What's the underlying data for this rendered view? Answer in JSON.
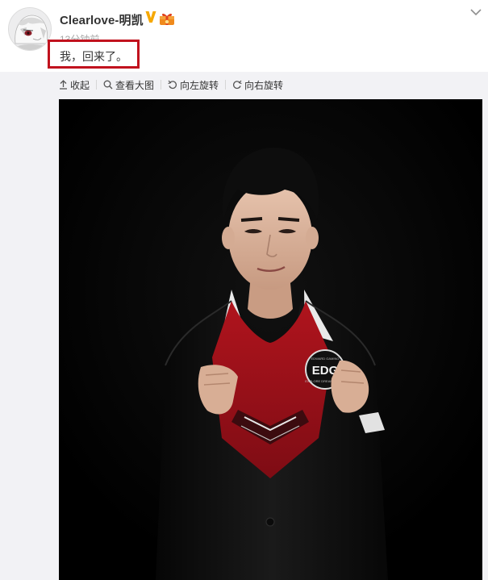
{
  "post": {
    "username": "Clearlove-明凯",
    "time": "13分钟前",
    "text": "我，回来了。"
  },
  "badges": {
    "verified": "verified-v-icon",
    "gift": "gift-icon",
    "verified_color": "#f6a800"
  },
  "toolbar": {
    "collapse": "收起",
    "view_large": "查看大图",
    "rotate_left": "向左旋转",
    "rotate_right": "向右旋转"
  },
  "photo": {
    "logo_text": "EDG",
    "logo_top_text": "EDWARD GAMING",
    "logo_bottom_text": "EXPLORE DREAM GLORY"
  },
  "colors": {
    "highlight": "#c1121e",
    "text": "#333333",
    "muted": "#a5a5a5",
    "media_bg": "#f2f2f5",
    "shirt": "#b0141d"
  }
}
